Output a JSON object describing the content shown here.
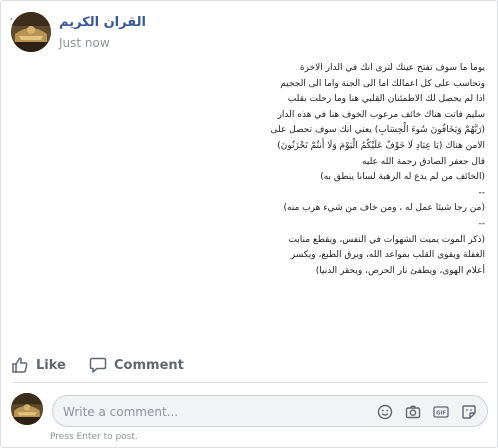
{
  "header": {
    "page_name": "القران الكريم",
    "timestamp": "Just now",
    "more_label": "..."
  },
  "post": {
    "lines": [
      "يوما ما سوف تفتح عينك لترى انك في الدار الاخرة",
      "وتحاسب على كل اعمالك اما الى الجنة واما الى الجحيم",
      "اذا لم يحصل لك الاطمئنان القلبي هنا وما رحلت بقلب",
      "سليم فاتت هناك خائف مرعوب الخوف هنا في هذه الدار",
      "(رَبَّهُمْ وَيَخَافُونَ سُوءَ الْحِسَابِ) يعني انك سوف تحصل على",
      "الامن هناك (يَا عِبَادِ لَا خَوْفٌ عَلَيْكُمُ الْيَوْمَ وَلَا أَنتُمْ تَحْزَنُونَ)",
      "قال جعفر الصادق رحمة الله عليه",
      "(الخائف من لم يدع له الرهبة لسانا ينطق به)",
      "--",
      "(من رجا شيئا عمل له ، ومن خاف من شيء هرب منه)",
      "--",
      "(ذكر الموت يميت الشهوات في النفس، ويقطع منابت",
      "الغفلة ويقوي القلب بمواعد الله، ويرق الطبع، ويكسر",
      "أعلام الهوى، ويطفئ نار الحرص، ويحقر الدنيا)"
    ]
  },
  "actions": {
    "like_label": "Like",
    "comment_label": "Comment"
  },
  "comment_box": {
    "placeholder": "Write a comment...",
    "hint": "Press Enter to post."
  },
  "colors": {
    "link": "#385898",
    "muted": "#90949c",
    "action": "#606770"
  }
}
